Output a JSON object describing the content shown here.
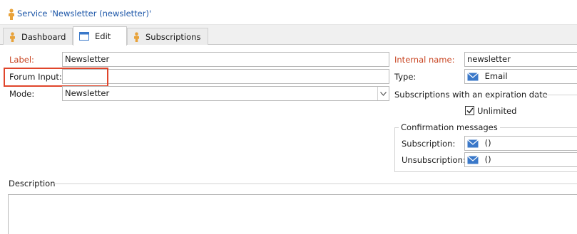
{
  "window": {
    "title": "Service 'Newsletter (newsletter)'"
  },
  "tabs": [
    {
      "label": "Dashboard",
      "icon": "person-icon"
    },
    {
      "label": "Edit",
      "icon": "window-icon"
    },
    {
      "label": "Subscriptions",
      "icon": "person-icon"
    }
  ],
  "form": {
    "label_label": "Label:",
    "label_value": "Newsletter",
    "forum_input_label": "Forum Input:",
    "forum_input_value": "",
    "mode_label": "Mode:",
    "mode_value": "Newsletter",
    "internal_name_label": "Internal name:",
    "internal_name_value": "newsletter",
    "type_label": "Type:",
    "type_value": "Email",
    "expiration_group": "Subscriptions with an expiration date",
    "unlimited_label": "Unlimited",
    "unlimited_checked": true,
    "confirmation_group": "Confirmation messages",
    "subscription_label": "Subscription:",
    "subscription_value": "()",
    "unsubscription_label": "Unsubscription:",
    "unsubscription_value": "()",
    "description_label": "Description"
  },
  "colors": {
    "title_blue": "#1c56a8",
    "required_red": "#c84421",
    "highlight_red": "#e0452b",
    "person_orange": "#e8a23a",
    "envelope_blue": "#3a78c9"
  }
}
